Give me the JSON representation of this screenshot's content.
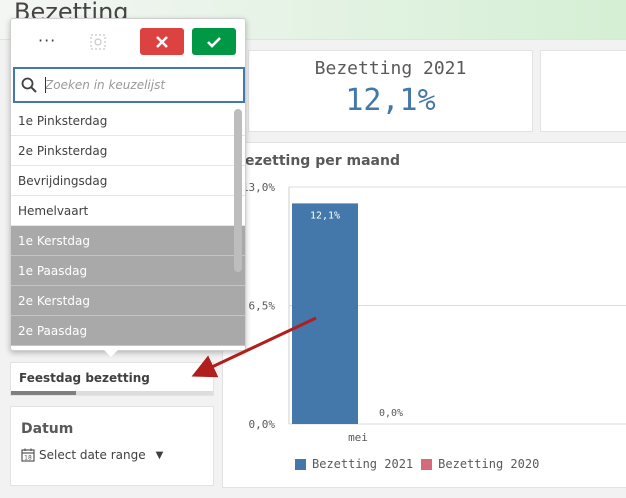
{
  "sheet": {
    "title": "Bezetting"
  },
  "kpi": {
    "title": "Bezetting 2021",
    "value": "12,1%"
  },
  "chart": {
    "title": "bezetting per maand",
    "legend": [
      {
        "label": "Bezetting 2021",
        "color": "#4477aa"
      },
      {
        "label": "Bezetting 2020",
        "color": "#d56a7b"
      }
    ]
  },
  "chart_data": {
    "type": "bar",
    "title": "bezetting per maand",
    "categories": [
      "mei"
    ],
    "series": [
      {
        "name": "Bezetting 2021",
        "values": [
          12.1
        ],
        "labels": [
          "12,1%"
        ],
        "color": "#4477aa"
      },
      {
        "name": "Bezetting 2020",
        "values": [
          0.0
        ],
        "labels": [
          "0,0%"
        ],
        "color": "#d56a7b"
      }
    ],
    "ylim": [
      0,
      13
    ],
    "yticks": [
      0,
      6.5,
      13
    ],
    "ytick_labels": [
      "0,0%",
      "6,5%",
      "13,0%"
    ],
    "grid": true,
    "legend_position": "bottom"
  },
  "filter": {
    "label": "Feestdag bezetting",
    "fill_fraction": 0.32
  },
  "date": {
    "title": "Datum",
    "range_label": "Select date range"
  },
  "listbox": {
    "search_placeholder": "Zoeken in keuzelijst",
    "more_label": "···",
    "items": [
      {
        "label": "1e Pinksterdag",
        "state": "possible"
      },
      {
        "label": "2e Pinksterdag",
        "state": "possible"
      },
      {
        "label": "Bevrijdingsdag",
        "state": "possible"
      },
      {
        "label": "Hemelvaart",
        "state": "possible"
      },
      {
        "label": "1e Kerstdag",
        "state": "alternative"
      },
      {
        "label": "1e Paasdag",
        "state": "alternative"
      },
      {
        "label": "2e Kerstdag",
        "state": "alternative"
      },
      {
        "label": "2e Paasdag",
        "state": "alternative"
      }
    ]
  },
  "colors": {
    "accent": "#4477aa",
    "cancel": "#dc423f",
    "confirm": "#009845",
    "annotation_arrow": "#b01e1e"
  }
}
